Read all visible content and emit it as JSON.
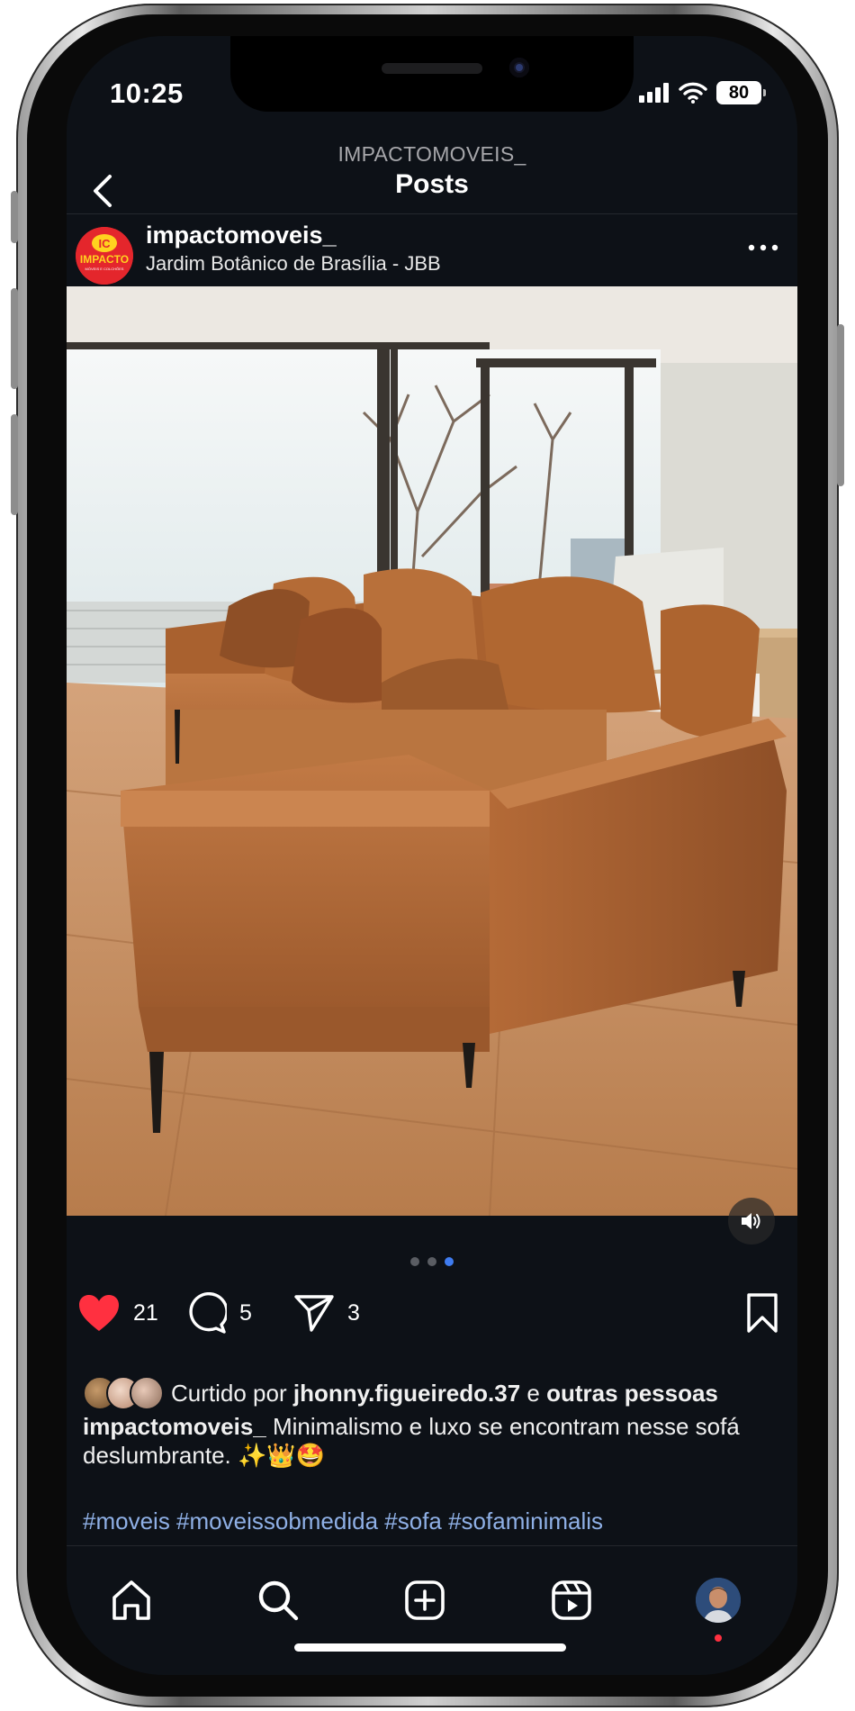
{
  "status_bar": {
    "time": "10:25",
    "battery": "80"
  },
  "header": {
    "username": "IMPACTOMOVEIS_",
    "title": "Posts"
  },
  "post": {
    "author": "impactomoveis_",
    "location": "Jardim Botânico de Brasília - JBB",
    "logo_text": {
      "mark": "IC",
      "name": "IMPACTO",
      "tagline": "MÓVEIS E COLCHÕES"
    },
    "carousel": {
      "current_index": 3,
      "total": 3
    }
  },
  "actions": {
    "likes": "21",
    "comments": "5",
    "shares": "3"
  },
  "likes": {
    "prefix": "Curtido por",
    "user": "jhonny.figueiredo.37",
    "connector": "e",
    "others": "outras pessoas"
  },
  "caption": {
    "author": "impactomoveis_",
    "text": "Minimalismo e luxo se encontram nesse sofá deslumbrante. ✨👑🤩",
    "hashtags": "#moveis #moveissobmedida #sofa #sofaminimalis"
  },
  "nav": [
    "home-icon",
    "search-icon",
    "create-post-icon",
    "reels-icon",
    "profile-avatar"
  ],
  "colors": {
    "background": "#0d1117",
    "like_red": "#ff3040",
    "hashtag": "#8fb0e6",
    "active_dot": "#3f7cf0"
  }
}
